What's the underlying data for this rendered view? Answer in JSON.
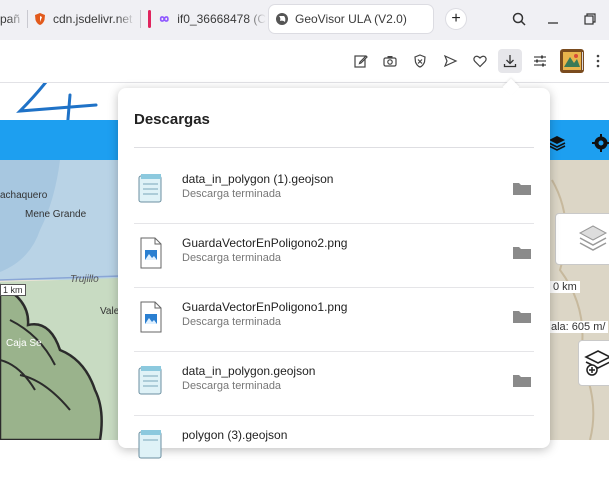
{
  "tabs": [
    {
      "title": "pañ"
    },
    {
      "title": "cdn.jsdelivr.net"
    },
    {
      "title": "if0_36668478 (C"
    },
    {
      "title": "GeoVisor ULA (V2.0)"
    }
  ],
  "map": {
    "labels": {
      "pachaquero": "achaquero",
      "mene_grande": "Mene Grande",
      "trujillo": "Trujillo",
      "valera": "Vale",
      "caja_seca": "Caja Se",
      "scale_left": "1 km",
      "scale_right": "0 km",
      "elev": "ala: 605 m/"
    }
  },
  "downloads": {
    "title": "Descargas",
    "items": [
      {
        "name": "data_in_polygon (1).geojson",
        "status": "Descarga terminada",
        "type": "geojson"
      },
      {
        "name": "GuardaVectorEnPoligono2.png",
        "status": "Descarga terminada",
        "type": "png"
      },
      {
        "name": "GuardaVectorEnPoligono1.png",
        "status": "Descarga terminada",
        "type": "png"
      },
      {
        "name": "data_in_polygon.geojson",
        "status": "Descarga terminada",
        "type": "geojson"
      },
      {
        "name": "polygon (3).geojson",
        "status": "",
        "type": "geojson"
      }
    ]
  },
  "colors": {
    "accent": "#1d9ff0",
    "tabbar": "#f0f0f4",
    "firefox_purple": "#9059ff"
  }
}
